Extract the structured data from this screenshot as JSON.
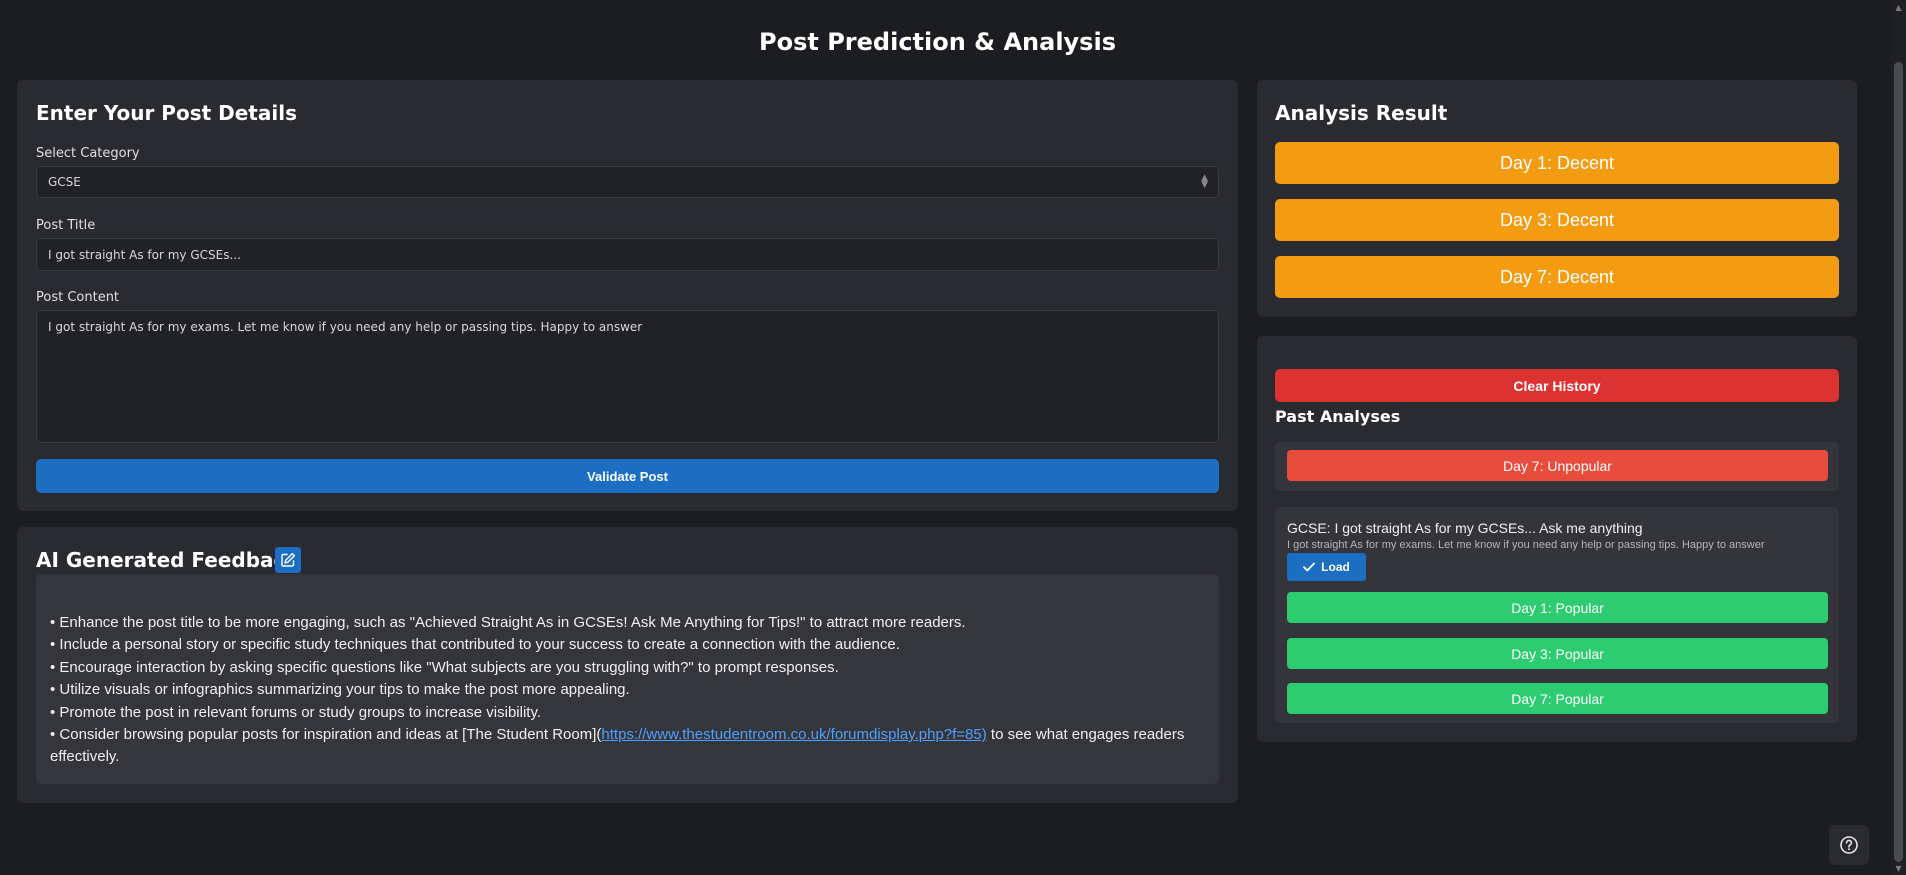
{
  "page": {
    "title": "Post Prediction & Analysis"
  },
  "form": {
    "heading": "Enter Your Post Details",
    "category_label": "Select Category",
    "category_value": "GCSE",
    "title_label": "Post Title",
    "title_value": "I got straight As for my GCSEs...",
    "content_label": "Post Content",
    "content_value": "I got straight As for my exams. Let me know if you need any help or passing tips. Happy to answer",
    "submit_label": "Validate Post"
  },
  "feedback": {
    "heading": "AI Generated Feedback",
    "edit_icon": "edit-icon",
    "items": [
      "• Enhance the post title to be more engaging, such as \"Achieved Straight As in GCSEs! Ask Me Anything for Tips!\" to attract more readers.",
      "• Include a personal story or specific study techniques that contributed to your success to create a connection with the audience.",
      "• Encourage interaction by asking specific questions like \"What subjects are you struggling with?\" to prompt responses.",
      "• Utilize visuals or infographics summarizing your tips to make the post more appealing.",
      "• Promote the post in relevant forums or study groups to increase visibility."
    ],
    "last_item_prefix": "• Consider browsing popular posts for inspiration and ideas at [The Student Room](",
    "last_item_link": "https://www.thestudentroom.co.uk/forumdisplay.php?f=85)",
    "last_item_suffix": " to see what engages readers effectively."
  },
  "analysis": {
    "heading": "Analysis Result",
    "results": [
      "Day 1: Decent",
      "Day 3: Decent",
      "Day 7: Decent"
    ],
    "result_color": "#f39c12"
  },
  "history": {
    "clear_label": "Clear History",
    "heading": "Past Analyses",
    "entry1": {
      "results": [
        "Day 7: Unpopular"
      ],
      "color": "#e74c3c"
    },
    "entry2": {
      "title": "GCSE: I got straight As for my GCSEs... Ask me anything",
      "content": "I got straight As for my exams. Let me know if you need any help or passing tips. Happy to answer",
      "load_label": "Load",
      "load_icon": "check-icon",
      "results": [
        "Day 1: Popular",
        "Day 3: Popular",
        "Day 7: Popular"
      ],
      "color": "#2ecc71"
    }
  },
  "help": {
    "icon": "help-circle-icon"
  },
  "colors": {
    "accent": "#1b6ec2",
    "danger": "#dc3232",
    "background": "#1c1d21",
    "panel": "#2a2b30"
  }
}
